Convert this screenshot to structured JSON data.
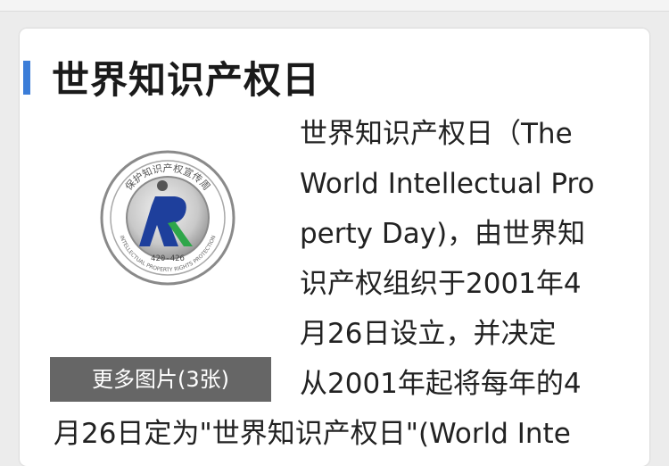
{
  "article": {
    "title": "世界知识产权日",
    "more_images_label": "更多图片(3张)",
    "body_lines": [
      "世界知识产权日（The",
      "World Intellectual Pro",
      "perty Day)，由世界知",
      "识产权组织于2001年4",
      "月26日设立，并决定",
      "从2001年起将每年的4",
      "月26日定为\"世界知识产权日\"(World Inte"
    ],
    "logo": {
      "icon": "intellectual-property-logo-icon",
      "top_text": "保护知识产权宣传周",
      "bottom_text": "INTELLECTUAL PROPERTY RIGHTS PROTECTION",
      "code": "420-426",
      "colors": {
        "blue": "#1e3f9c",
        "green": "#2ea64a",
        "ring": "#7d7d7d"
      }
    },
    "accent_color": "#3b7dd8"
  }
}
